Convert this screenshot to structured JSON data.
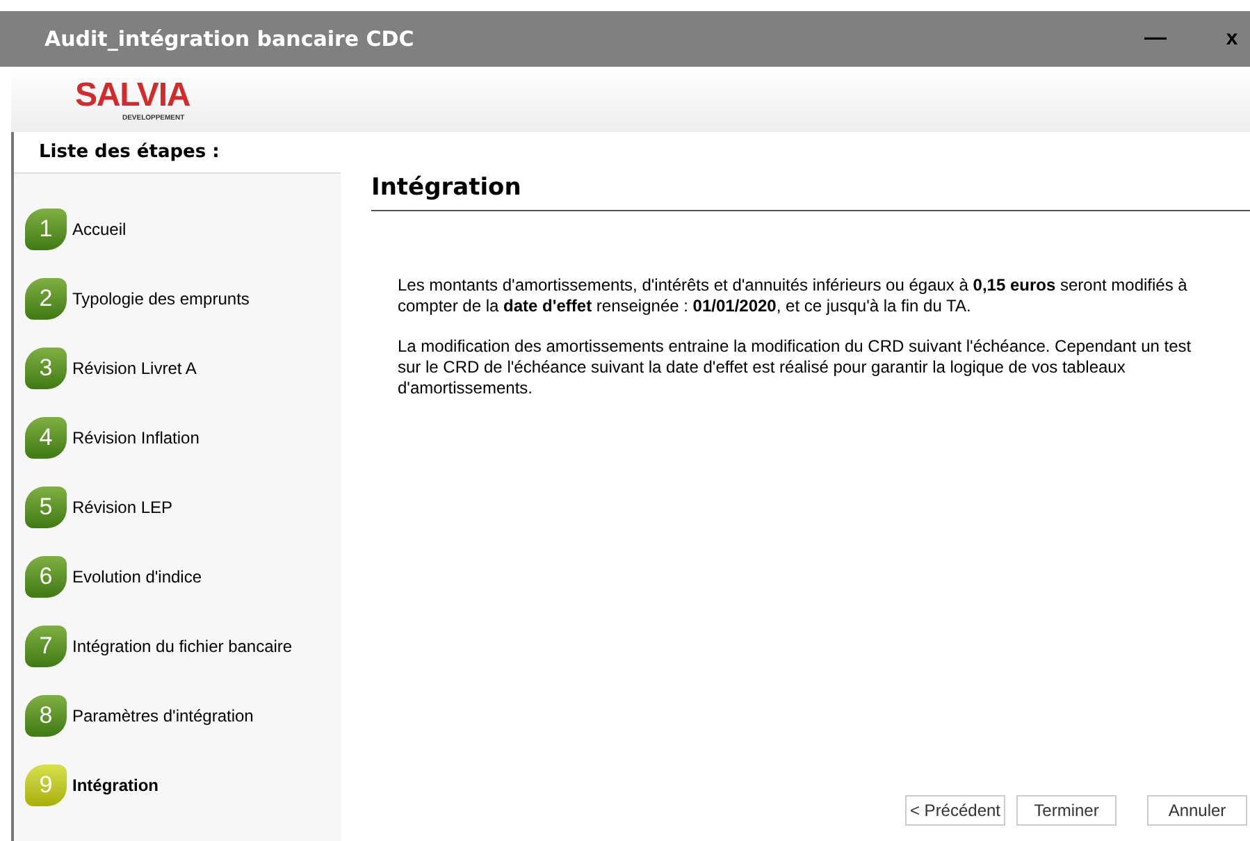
{
  "window": {
    "title": "Audit_intégration bancaire CDC",
    "controls": [
      "—",
      "x"
    ]
  },
  "logo": {
    "name": "SALVIA",
    "subtitle": "DEVELOPPEMENT"
  },
  "sidebar": {
    "title": "Liste des étapes :",
    "steps": [
      {
        "number": "1",
        "label": "Accueil",
        "selected": false
      },
      {
        "number": "2",
        "label": "Typologie des emprunts",
        "selected": false
      },
      {
        "number": "3",
        "label": "Révision Livret A",
        "selected": false
      },
      {
        "number": "4",
        "label": "Révision Inflation",
        "selected": false
      },
      {
        "number": "5",
        "label": "Révision LEP",
        "selected": false
      },
      {
        "number": "6",
        "label": "Evolution d'indice",
        "selected": false
      },
      {
        "number": "7",
        "label": "Intégration du fichier bancaire",
        "selected": false
      },
      {
        "number": "8",
        "label": "Paramètres d'intégration",
        "selected": false
      },
      {
        "number": "9",
        "label": "Intégration",
        "selected": true
      }
    ]
  },
  "content": {
    "heading": "Intégration",
    "paragraphs": [
      "Les montants d'amortissements, d'intérêts et d'annuités inférieurs ou égaux à  **0,15 euros** seront modifiés à compter de la **date d'effet** renseignée :  **01/01/2020**, et ce jusqu'à la fin du TA.",
      "La modification des amortissements entraine la modification du CRD suivant l'échéance. Cependant un test sur le CRD de l'échéance suivant la date d'effet est réalisé pour garantir la logique de vos tableaux d'amortissements."
    ]
  },
  "buttons": [
    "< Précédent",
    "Terminer",
    "Annuler"
  ]
}
